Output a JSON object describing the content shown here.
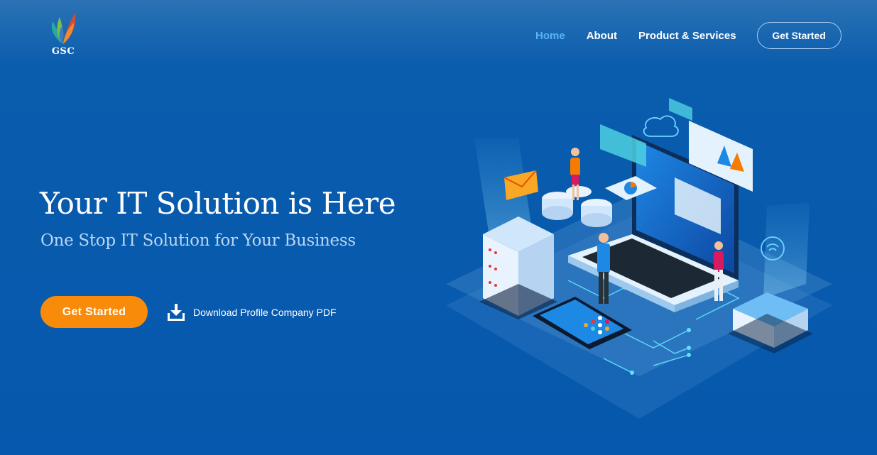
{
  "brand": {
    "logo_text": "GSC"
  },
  "nav": {
    "items": [
      {
        "label": "Home",
        "active": true
      },
      {
        "label": "About",
        "active": false
      },
      {
        "label": "Product & Services",
        "active": false
      }
    ],
    "cta_label": "Get Started"
  },
  "hero": {
    "title": "Your IT Solution is Here",
    "subtitle": "One Stop IT Solution for Your Business",
    "cta_label": "Get Started",
    "download_label": "Download Profile Company PDF"
  },
  "colors": {
    "background": "#0558ad",
    "accent_orange": "#f98b0a",
    "nav_active": "#57b4f5",
    "subtitle": "#b9d6f2"
  },
  "icons": {
    "download": "download-icon",
    "logo": "leaf-logo-icon"
  }
}
